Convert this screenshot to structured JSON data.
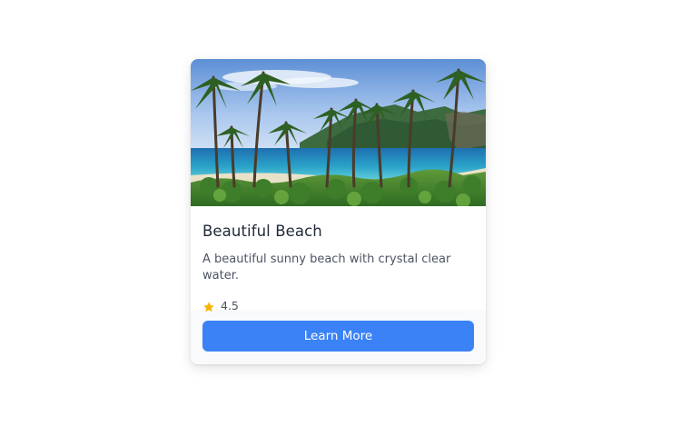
{
  "card": {
    "image_alt": "Beautiful Beach",
    "title": "Beautiful Beach",
    "description": "A beautiful sunny beach with crystal clear water.",
    "rating": "4.5",
    "button_label": "Learn More"
  },
  "icons": {
    "rating": "star-icon"
  },
  "colors": {
    "accent": "#3b82f6",
    "star": "#f5b301",
    "title": "#1f2937",
    "text": "#4b5563",
    "footer_bg": "#f9fafb"
  }
}
